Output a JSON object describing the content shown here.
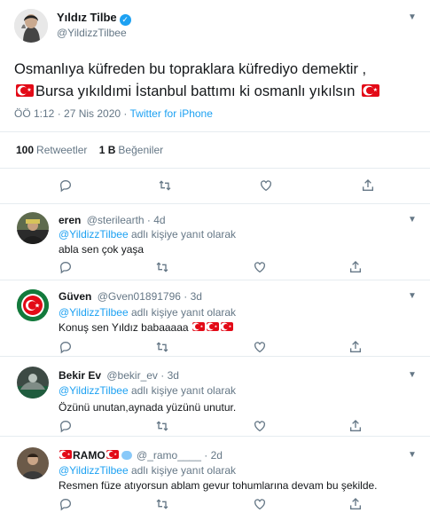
{
  "tweet": {
    "author_name": "Yıldız Tilbe",
    "handle": "@YildizzTilbee",
    "text_line1": "Osmanlıya küfreden  bu topraklara küfrediyo demektir ,",
    "text_line2": "Bursa yıkıldımi İstanbul battımı ki osmanlı yıkılsın",
    "time": "ÖÖ 1:12 · 27 Nis 2020 · ",
    "source": "Twitter for iPhone",
    "retweets_count": "100",
    "retweets_label": "Retweetler",
    "likes_count": "1 B",
    "likes_label": "Beğeniler"
  },
  "replies": [
    {
      "name": "eren",
      "handle": "@sterilearth",
      "age": "· 4d",
      "mention": "@YildizzTilbee",
      "reply_label": "adlı kişiye yanıt olarak",
      "text": "abla sen çok yaşa"
    },
    {
      "name": "Güven",
      "handle": "@Gven01891796",
      "age": "· 3d",
      "mention": "@YildizzTilbee",
      "reply_label": "adlı kişiye yanıt olarak",
      "text": "Konuş sen Yıldız babaaaaa"
    },
    {
      "name": "Bekir Ev",
      "handle": "@bekir_ev",
      "age": "· 3d",
      "mention": "@YildizzTilbee",
      "reply_label": "adlı kişiye yanıt olarak",
      "text": "Özünü unutan,aynada yüzünü unutur."
    },
    {
      "name": "RAMO",
      "handle": "@_ramo____",
      "age": "· 2d",
      "mention": "@YildizzTilbee",
      "reply_label": "adlı kişiye yanıt olarak",
      "text": "Resmen füze atıyorsun ablam gevur tohumlarına devam bu şekilde."
    }
  ],
  "colors": {
    "accent": "#1da1f2",
    "muted": "#657786",
    "flag": "#e30a17"
  },
  "icons": [
    "reply-icon",
    "retweet-icon",
    "like-icon",
    "share-icon",
    "chevron-down-icon",
    "verified-icon"
  ]
}
